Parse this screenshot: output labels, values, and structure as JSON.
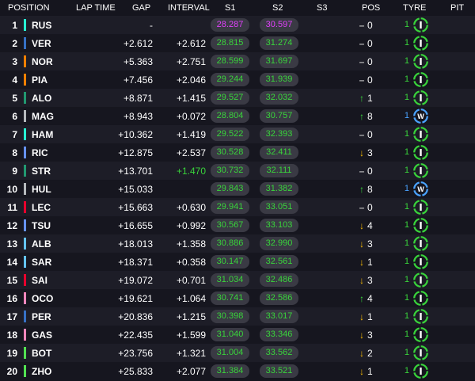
{
  "header": {
    "position": "POSITION",
    "lap_time": "LAP TIME",
    "gap": "GAP",
    "interval": "INTERVAL",
    "s1": "S1",
    "s2": "S2",
    "s3": "S3",
    "pos": "POS",
    "tyre": "TYRE",
    "pit": "PIT"
  },
  "colors": {
    "background": "#15151e",
    "row_odd": "#1d1d27",
    "row_even": "#16161f",
    "sector_green": "#39d43b",
    "sector_purple": "#e040fb",
    "gain": "#39d43b",
    "loss": "#f2b705",
    "tyre_intermediate": "#39d43b",
    "tyre_wet": "#4aa3ff"
  },
  "rows": [
    {
      "pos": "1",
      "code": "RUS",
      "team_color": "#27f4d2",
      "gap": "-",
      "interval": "",
      "s1": "28.287",
      "s1_class": "purple",
      "s2": "30.597",
      "s2_class": "purple",
      "arrow": "same",
      "pos_change": "0",
      "laps": "1",
      "tyre": "I"
    },
    {
      "pos": "2",
      "code": "VER",
      "team_color": "#3671c6",
      "gap": "+2.612",
      "interval": "+2.612",
      "s1": "28.815",
      "s1_class": "green",
      "s2": "31.274",
      "s2_class": "green",
      "arrow": "same",
      "pos_change": "0",
      "laps": "1",
      "tyre": "I"
    },
    {
      "pos": "3",
      "code": "NOR",
      "team_color": "#ff8000",
      "gap": "+5.363",
      "interval": "+2.751",
      "s1": "28.599",
      "s1_class": "green",
      "s2": "31.697",
      "s2_class": "green",
      "arrow": "same",
      "pos_change": "0",
      "laps": "1",
      "tyre": "I"
    },
    {
      "pos": "4",
      "code": "PIA",
      "team_color": "#ff8000",
      "gap": "+7.456",
      "interval": "+2.046",
      "s1": "29.244",
      "s1_class": "green",
      "s2": "31.939",
      "s2_class": "green",
      "arrow": "same",
      "pos_change": "0",
      "laps": "1",
      "tyre": "I"
    },
    {
      "pos": "5",
      "code": "ALO",
      "team_color": "#229971",
      "gap": "+8.871",
      "interval": "+1.415",
      "s1": "29.527",
      "s1_class": "green",
      "s2": "32.032",
      "s2_class": "green",
      "arrow": "up",
      "pos_change": "1",
      "laps": "1",
      "tyre": "I"
    },
    {
      "pos": "6",
      "code": "MAG",
      "team_color": "#b6babd",
      "gap": "+8.943",
      "interval": "+0.072",
      "s1": "28.804",
      "s1_class": "green",
      "s2": "30.757",
      "s2_class": "green",
      "arrow": "up",
      "pos_change": "8",
      "laps": "1",
      "tyre": "W"
    },
    {
      "pos": "7",
      "code": "HAM",
      "team_color": "#27f4d2",
      "gap": "+10.362",
      "interval": "+1.419",
      "s1": "29.522",
      "s1_class": "green",
      "s2": "32.393",
      "s2_class": "green",
      "arrow": "same",
      "pos_change": "0",
      "laps": "1",
      "tyre": "I"
    },
    {
      "pos": "8",
      "code": "RIC",
      "team_color": "#6692ff",
      "gap": "+12.875",
      "interval": "+2.537",
      "s1": "30.528",
      "s1_class": "green",
      "s2": "32.411",
      "s2_class": "green",
      "arrow": "down",
      "pos_change": "3",
      "laps": "1",
      "tyre": "I"
    },
    {
      "pos": "9",
      "code": "STR",
      "team_color": "#229971",
      "gap": "+13.701",
      "interval": "+1.470",
      "interval_class": "green",
      "s1": "30.732",
      "s1_class": "green",
      "s2": "32.111",
      "s2_class": "green",
      "arrow": "same",
      "pos_change": "0",
      "laps": "1",
      "tyre": "I"
    },
    {
      "pos": "10",
      "code": "HUL",
      "team_color": "#b6babd",
      "gap": "+15.033",
      "interval": "",
      "s1": "29.843",
      "s1_class": "green",
      "s2": "31.382",
      "s2_class": "green",
      "arrow": "up",
      "pos_change": "8",
      "laps": "1",
      "tyre": "W"
    },
    {
      "pos": "11",
      "code": "LEC",
      "team_color": "#e8002d",
      "gap": "+15.663",
      "interval": "+0.630",
      "s1": "29.941",
      "s1_class": "green",
      "s2": "33.051",
      "s2_class": "green",
      "arrow": "same",
      "pos_change": "0",
      "laps": "1",
      "tyre": "I"
    },
    {
      "pos": "12",
      "code": "TSU",
      "team_color": "#6692ff",
      "gap": "+16.655",
      "interval": "+0.992",
      "s1": "30.567",
      "s1_class": "green",
      "s2": "33.103",
      "s2_class": "green",
      "arrow": "down",
      "pos_change": "4",
      "laps": "1",
      "tyre": "I"
    },
    {
      "pos": "13",
      "code": "ALB",
      "team_color": "#64c4ff",
      "gap": "+18.013",
      "interval": "+1.358",
      "s1": "30.886",
      "s1_class": "green",
      "s2": "32.990",
      "s2_class": "green",
      "arrow": "down",
      "pos_change": "3",
      "laps": "1",
      "tyre": "I"
    },
    {
      "pos": "14",
      "code": "SAR",
      "team_color": "#64c4ff",
      "gap": "+18.371",
      "interval": "+0.358",
      "s1": "30.147",
      "s1_class": "green",
      "s2": "32.561",
      "s2_class": "green",
      "arrow": "down",
      "pos_change": "1",
      "laps": "1",
      "tyre": "I"
    },
    {
      "pos": "15",
      "code": "SAI",
      "team_color": "#e8002d",
      "gap": "+19.072",
      "interval": "+0.701",
      "s1": "31.034",
      "s1_class": "green",
      "s2": "32.486",
      "s2_class": "green",
      "arrow": "down",
      "pos_change": "3",
      "laps": "1",
      "tyre": "I"
    },
    {
      "pos": "16",
      "code": "OCO",
      "team_color": "#ff87bc",
      "gap": "+19.621",
      "interval": "+1.064",
      "s1": "30.741",
      "s1_class": "green",
      "s2": "32.586",
      "s2_class": "green",
      "arrow": "up",
      "pos_change": "4",
      "laps": "1",
      "tyre": "I"
    },
    {
      "pos": "17",
      "code": "PER",
      "team_color": "#3671c6",
      "gap": "+20.836",
      "interval": "+1.215",
      "s1": "30.398",
      "s1_class": "green",
      "s2": "33.017",
      "s2_class": "green",
      "arrow": "down",
      "pos_change": "1",
      "laps": "1",
      "tyre": "I"
    },
    {
      "pos": "18",
      "code": "GAS",
      "team_color": "#ff87bc",
      "gap": "+22.435",
      "interval": "+1.599",
      "s1": "31.040",
      "s1_class": "green",
      "s2": "33.346",
      "s2_class": "green",
      "arrow": "down",
      "pos_change": "3",
      "laps": "1",
      "tyre": "I"
    },
    {
      "pos": "19",
      "code": "BOT",
      "team_color": "#52e252",
      "gap": "+23.756",
      "interval": "+1.321",
      "s1": "31.004",
      "s1_class": "green",
      "s2": "33.562",
      "s2_class": "green",
      "arrow": "down",
      "pos_change": "2",
      "laps": "1",
      "tyre": "I"
    },
    {
      "pos": "20",
      "code": "ZHO",
      "team_color": "#52e252",
      "gap": "+25.833",
      "interval": "+2.077",
      "s1": "31.384",
      "s1_class": "green",
      "s2": "33.521",
      "s2_class": "green",
      "arrow": "down",
      "pos_change": "1",
      "laps": "1",
      "tyre": "I"
    }
  ]
}
